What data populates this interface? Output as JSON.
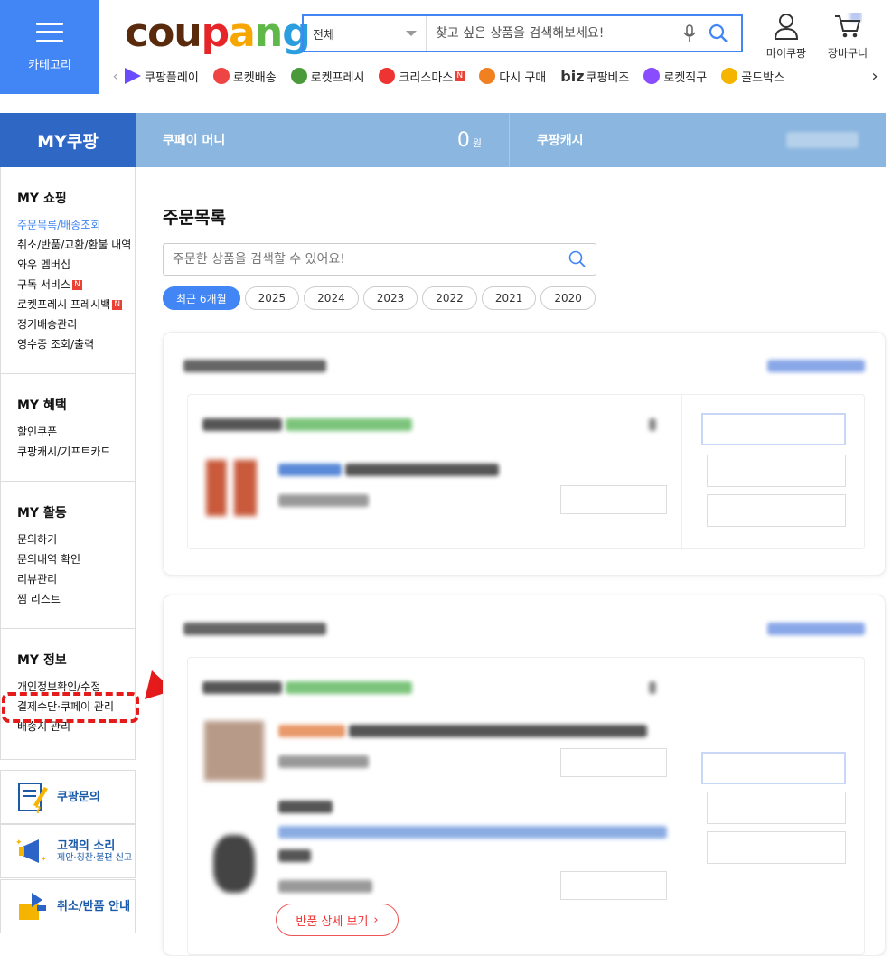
{
  "header": {
    "category_label": "카테고리",
    "logo": [
      "c",
      "o",
      "u",
      "p",
      "a",
      "n",
      "g"
    ],
    "logo_colors": [
      "#5a2a0c",
      "#5a2a0c",
      "#5a2a0c",
      "#e52528",
      "#f7a600",
      "#5fb848",
      "#2b9ede"
    ],
    "search": {
      "category": "전체",
      "placeholder": "찾고 싶은 상품을 검색해보세요!"
    },
    "my_coupang": "마이쿠팡",
    "cart": "장바구니"
  },
  "nav_strip": [
    {
      "label": "쿠팡플레이",
      "icon": "play-icon"
    },
    {
      "label": "로켓배송",
      "icon": "rocket-icon"
    },
    {
      "label": "로켓프레시",
      "icon": "rocket-fresh-icon"
    },
    {
      "label": "크리스마스",
      "icon": "santa-icon",
      "badge": "N"
    },
    {
      "label": "다시 구매",
      "icon": "rebuy-icon"
    },
    {
      "label": "쿠팡비즈",
      "icon": "biz-icon",
      "prefix": "biz"
    },
    {
      "label": "로켓직구",
      "icon": "global-rocket-icon"
    },
    {
      "label": "골드박스",
      "icon": "goldbox-icon"
    }
  ],
  "my_bar": {
    "title": "MY쿠팡",
    "pay_money_label": "쿠페이 머니",
    "pay_money_amount": "0",
    "pay_money_unit": "원",
    "cash_label": "쿠팡캐시"
  },
  "sidebar": {
    "sections": [
      {
        "title": "MY 쇼핑",
        "items": [
          "주문목록/배송조회",
          "취소/반품/교환/환불 내역",
          "와우 멤버십",
          "구독 서비스",
          "로켓프레시 프레시백",
          "정기배송관리",
          "영수증 조회/출력"
        ]
      },
      {
        "title": "MY 혜택",
        "items": [
          "할인쿠폰",
          "쿠팡캐시/기프트카드"
        ]
      },
      {
        "title": "MY 활동",
        "items": [
          "문의하기",
          "문의내역 확인",
          "리뷰관리",
          "찜 리스트"
        ]
      },
      {
        "title": "MY 정보",
        "items": [
          "개인정보확인/수정",
          "결제수단·쿠페이 관리",
          "배송지 관리"
        ]
      }
    ],
    "badge": "N"
  },
  "support": [
    {
      "label": "쿠팡문의",
      "sub": ""
    },
    {
      "label": "고객의 소리",
      "sub": "제안·칭찬·불편 신고"
    },
    {
      "label": "취소/반품 안내",
      "sub": ""
    }
  ],
  "main": {
    "title": "주문목록",
    "search_placeholder": "주문한 상품을 검색할 수 있어요!",
    "year_tabs": [
      "최근 6개월",
      "2025",
      "2024",
      "2023",
      "2022",
      "2021",
      "2020"
    ],
    "return_detail": "반품 상세 보기"
  },
  "colors": {
    "brand_blue": "#4285f4",
    "my_blue": "#2f67c5",
    "bar_blue": "#8ab6e0",
    "highlight_red": "#e51a1a"
  }
}
